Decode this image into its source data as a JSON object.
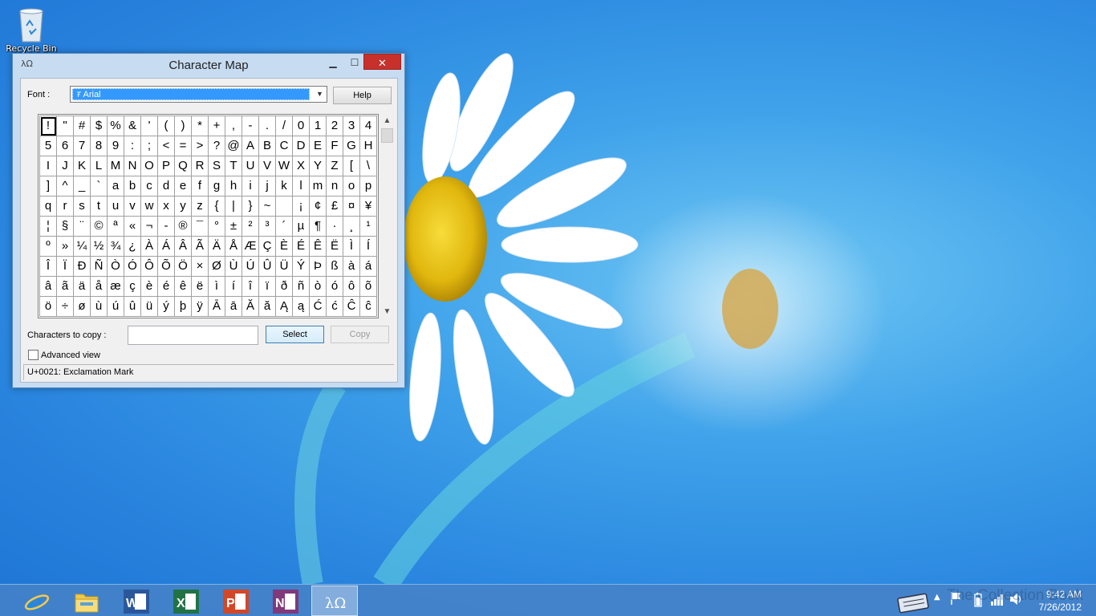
{
  "desktop": {
    "icons": [
      {
        "label": "Recycle Bin",
        "icon": "recycle-bin-icon"
      }
    ]
  },
  "window": {
    "title": "Character Map",
    "icon": "charmap-icon",
    "controls": {
      "minimize": "minimize-icon",
      "maximize": "maximize-icon",
      "close": "close-icon"
    },
    "font_label": "Font :",
    "font_value": "Arial",
    "help_label": "Help",
    "characters": [
      "!",
      "\"",
      "#",
      "$",
      "%",
      "&",
      "'",
      "(",
      ")",
      "*",
      "+",
      ",",
      "-",
      ".",
      "/",
      "0",
      "1",
      "2",
      "3",
      "4",
      "5",
      "6",
      "7",
      "8",
      "9",
      ":",
      ";",
      "<",
      "=",
      ">",
      "?",
      "@",
      "A",
      "B",
      "C",
      "D",
      "E",
      "F",
      "G",
      "H",
      "I",
      "J",
      "K",
      "L",
      "M",
      "N",
      "O",
      "P",
      "Q",
      "R",
      "S",
      "T",
      "U",
      "V",
      "W",
      "X",
      "Y",
      "Z",
      "[",
      "\\",
      "]",
      "^",
      "_",
      "`",
      "a",
      "b",
      "c",
      "d",
      "e",
      "f",
      "g",
      "h",
      "i",
      "j",
      "k",
      "l",
      "m",
      "n",
      "o",
      "p",
      "q",
      "r",
      "s",
      "t",
      "u",
      "v",
      "w",
      "x",
      "y",
      "z",
      "{",
      "|",
      "}",
      "~",
      " ",
      "¡",
      "¢",
      "£",
      "¤",
      "¥",
      "¦",
      "§",
      "¨",
      "©",
      "ª",
      "«",
      "¬",
      "-",
      "®",
      "¯",
      "°",
      "±",
      "²",
      "³",
      "´",
      "µ",
      "¶",
      "·",
      "¸",
      "¹",
      "º",
      "»",
      "¼",
      "½",
      "¾",
      "¿",
      "À",
      "Á",
      "Â",
      "Ã",
      "Ä",
      "Å",
      "Æ",
      "Ç",
      "È",
      "É",
      "Ê",
      "Ë",
      "Ì",
      "Í",
      "Î",
      "Ï",
      "Ð",
      "Ñ",
      "Ò",
      "Ó",
      "Ô",
      "Õ",
      "Ö",
      "×",
      "Ø",
      "Ù",
      "Ú",
      "Û",
      "Ü",
      "Ý",
      "Þ",
      "ß",
      "à",
      "á",
      "â",
      "ã",
      "ä",
      "å",
      "æ",
      "ç",
      "è",
      "é",
      "ê",
      "ë",
      "ì",
      "í",
      "î",
      "ï",
      "ð",
      "ñ",
      "ò",
      "ó",
      "ô",
      "õ",
      "ö",
      "÷",
      "ø",
      "ù",
      "ú",
      "û",
      "ü",
      "ý",
      "þ",
      "ÿ",
      "Ā",
      "ā",
      "Ă",
      "ă",
      "Ą",
      "ą",
      "Ć",
      "ć",
      "Ĉ",
      "ĉ"
    ],
    "selected_index": 0,
    "copy_label": "Characters to copy :",
    "copy_value": "",
    "select_label": "Select",
    "copy_button_label": "Copy",
    "advanced_label": "Advanced view",
    "advanced_checked": false,
    "status": "U+0021: Exclamation Mark"
  },
  "taskbar": {
    "apps": [
      {
        "name": "internet-explorer",
        "icon": "internet-explorer-icon",
        "active": false,
        "color": "#1e88e5"
      },
      {
        "name": "file-explorer",
        "icon": "file-explorer-icon",
        "active": false,
        "color": "#f2c94c"
      },
      {
        "name": "word",
        "icon": "word-icon",
        "active": false,
        "color": "#2b579a"
      },
      {
        "name": "excel",
        "icon": "excel-icon",
        "active": false,
        "color": "#217346"
      },
      {
        "name": "powerpoint",
        "icon": "powerpoint-icon",
        "active": false,
        "color": "#d24726"
      },
      {
        "name": "onenote",
        "icon": "onenote-icon",
        "active": false,
        "color": "#80397b"
      },
      {
        "name": "character-map",
        "icon": "charmap-icon",
        "active": true,
        "color": "#ffffff"
      }
    ],
    "tray": {
      "time": "9:42 AM",
      "date": "7/26/2012"
    },
    "watermark": "The Collection Book"
  }
}
